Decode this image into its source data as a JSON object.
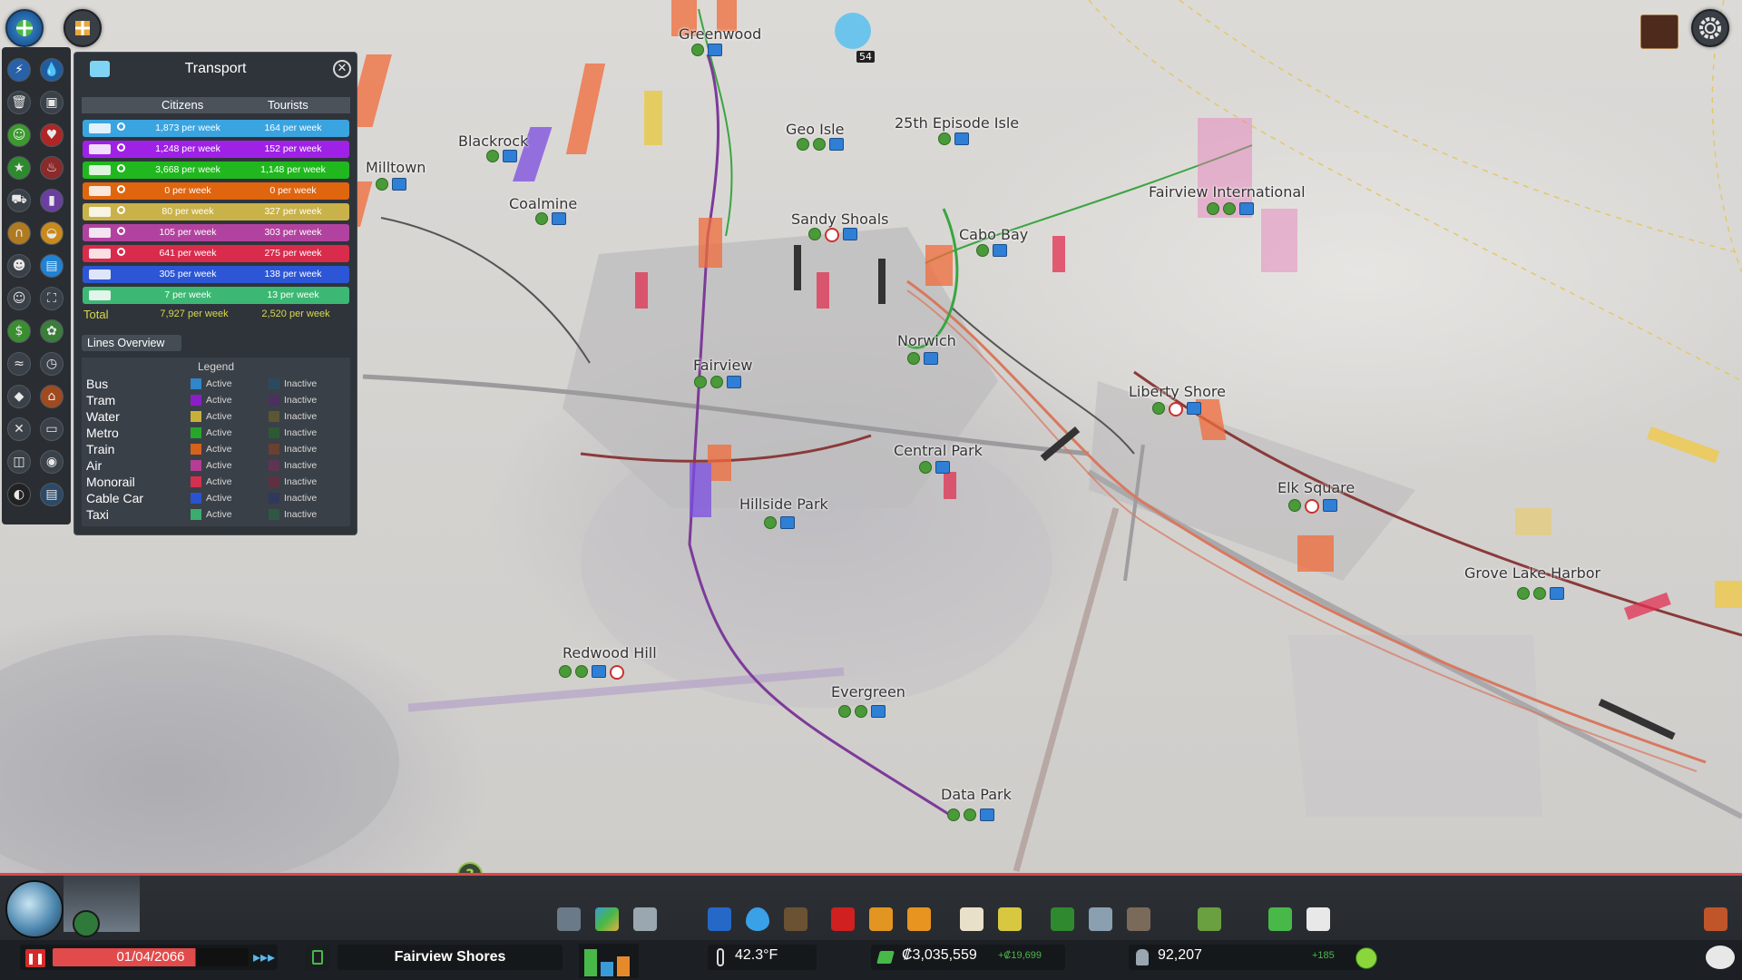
{
  "map": {
    "districts": [
      {
        "name": "Greenwood"
      },
      {
        "name": "Geo Isle"
      },
      {
        "name": "25th Episode Isle"
      },
      {
        "name": "Blackrock"
      },
      {
        "name": "Milltown"
      },
      {
        "name": "Coalmine"
      },
      {
        "name": "Sandy Shoals"
      },
      {
        "name": "Cabo Bay"
      },
      {
        "name": "Fairview International"
      },
      {
        "name": "Norwich"
      },
      {
        "name": "Fairview"
      },
      {
        "name": "Liberty Shore"
      },
      {
        "name": "Central Park"
      },
      {
        "name": "Elk Square"
      },
      {
        "name": "Hillside Park"
      },
      {
        "name": "Grove Lake Harbor"
      },
      {
        "name": "Redwood Hill"
      },
      {
        "name": "Evergreen"
      },
      {
        "name": "Data Park"
      }
    ],
    "vehicle_badge_count": "54",
    "help_label": "?"
  },
  "panel": {
    "title": "Transport",
    "close_label": "✕",
    "header": {
      "citizens": "Citizens",
      "tourists": "Tourists"
    },
    "rows": [
      {
        "mode": "bus",
        "color": "#3aa4e0",
        "citizens": "1,873 per week",
        "tourists": "164 per week"
      },
      {
        "mode": "tram",
        "color": "#a021e6",
        "citizens": "1,248 per week",
        "tourists": "152 per week"
      },
      {
        "mode": "metro",
        "color": "#20b81e",
        "citizens": "3,668 per week",
        "tourists": "1,148 per week"
      },
      {
        "mode": "train",
        "color": "#e0650f",
        "citizens": "0 per week",
        "tourists": "0 per week"
      },
      {
        "mode": "ship",
        "color": "#c9b24a",
        "citizens": "80 per week",
        "tourists": "327 per week"
      },
      {
        "mode": "air",
        "color": "#b2429f",
        "citizens": "105 per week",
        "tourists": "303 per week"
      },
      {
        "mode": "monorail",
        "color": "#d92b4c",
        "citizens": "641 per week",
        "tourists": "275 per week"
      },
      {
        "mode": "cablecar",
        "color": "#2c56d6",
        "citizens": "305 per week",
        "tourists": "138 per week"
      },
      {
        "mode": "taxi",
        "color": "#3db874",
        "citizens": "7 per week",
        "tourists": "13 per week"
      }
    ],
    "total": {
      "label": "Total",
      "citizens": "7,927 per week",
      "tourists": "2,520 per week"
    },
    "lines_tab": "Lines Overview",
    "legend": {
      "title": "Legend",
      "active_label": "Active",
      "inactive_label": "Inactive",
      "rows": [
        {
          "name": "Bus",
          "active": "#2f86c8",
          "inactive": "#2b4a60"
        },
        {
          "name": "Tram",
          "active": "#8a1fc9",
          "inactive": "#4b3060"
        },
        {
          "name": "Water",
          "active": "#c7b03a",
          "inactive": "#5c5632"
        },
        {
          "name": "Metro",
          "active": "#27a62c",
          "inactive": "#2d5a33"
        },
        {
          "name": "Train",
          "active": "#d6621b",
          "inactive": "#6a4030"
        },
        {
          "name": "Air",
          "active": "#b53d96",
          "inactive": "#5e3452"
        },
        {
          "name": "Monorail",
          "active": "#d5304f",
          "inactive": "#5e3040"
        },
        {
          "name": "Cable Car",
          "active": "#2b52cf",
          "inactive": "#30385e"
        },
        {
          "name": "Taxi",
          "active": "#3aad6e",
          "inactive": "#2e5844"
        }
      ]
    }
  },
  "bottom": {
    "date": "01/04/2066",
    "city_name": "Fairview Shores",
    "temperature": "42.3°F",
    "money": "₡3,035,559",
    "money_delta": "+₡19,699",
    "population": "92,207",
    "population_delta": "+185"
  },
  "colors": {
    "accent_red": "#e0474a",
    "panel_bg": "#2f343a"
  }
}
